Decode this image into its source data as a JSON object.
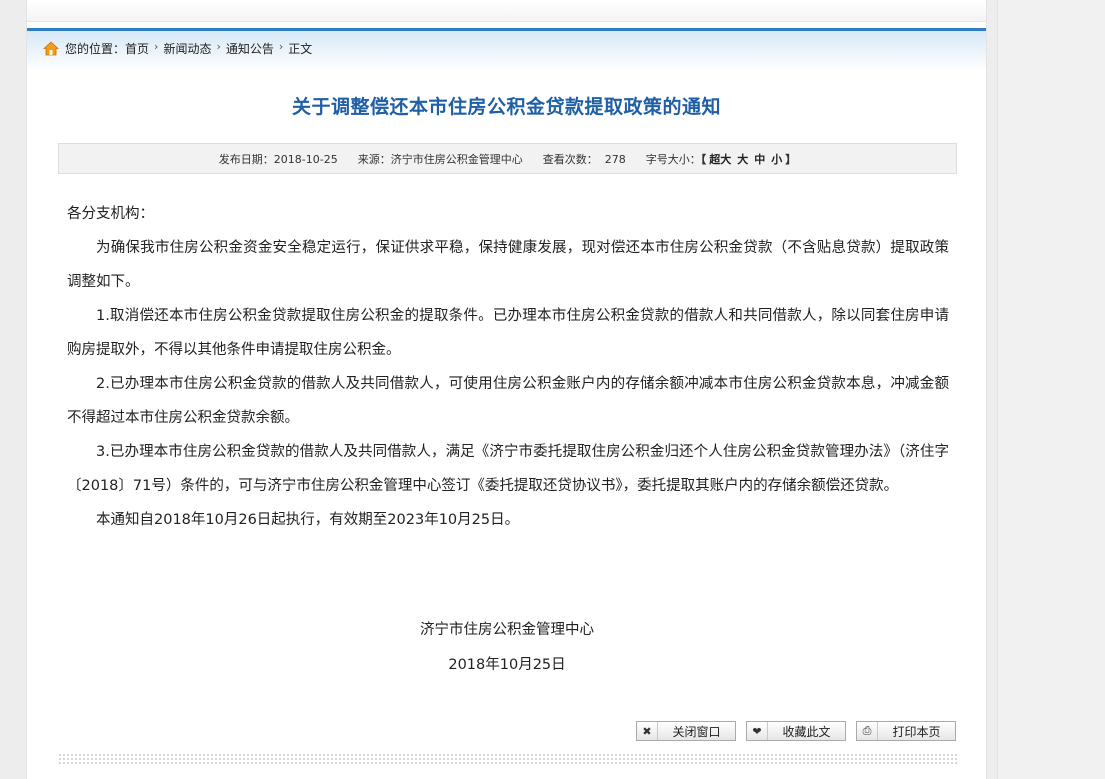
{
  "breadcrumb": {
    "label": "您的位置：",
    "items": [
      "首页",
      "新闻动态",
      "通知公告",
      "正文"
    ]
  },
  "article": {
    "title": "关于调整偿还本市住房公积金贷款提取政策的通知",
    "meta": {
      "date_label": "发布日期：",
      "date": "2018-10-25",
      "source_label": "来源：",
      "source": "济宁市住房公积金管理中心",
      "views_label": "查看次数：",
      "views": "278",
      "font_label": "字号大小：",
      "bracket_open": "【",
      "bracket_close": "】",
      "font_options": [
        "超大",
        "大",
        "中",
        "小"
      ]
    },
    "salutation": "各分支机构：",
    "paragraphs": [
      "为确保我市住房公积金资金安全稳定运行，保证供求平稳，保持健康发展，现对偿还本市住房公积金贷款（不含贴息贷款）提取政策调整如下。",
      "1.取消偿还本市住房公积金贷款提取住房公积金的提取条件。已办理本市住房公积金贷款的借款人和共同借款人，除以同套住房申请购房提取外，不得以其他条件申请提取住房公积金。",
      "2.已办理本市住房公积金贷款的借款人及共同借款人，可使用住房公积金账户内的存储余额冲减本市住房公积金贷款本息，冲减金额不得超过本市住房公积金贷款余额。",
      "3.已办理本市住房公积金贷款的借款人及共同借款人，满足《济宁市委托提取住房公积金归还个人住房公积金贷款管理办法》（济住字〔2018〕71号）条件的，可与济宁市住房公积金管理中心签订《委托提取还贷协议书》，委托提取其账户内的存储余额偿还贷款。",
      "本通知自2018年10月26日起执行，有效期至2023年10月25日。"
    ],
    "signature_org": "济宁市住房公积金管理中心",
    "signature_date": "2018年10月25日"
  },
  "actions": {
    "close_icon": "✖",
    "close_label": "关闭窗口",
    "favorite_icon": "❤",
    "favorite_label": "收藏此文",
    "print_icon": "⎙",
    "print_label": "打印本页"
  },
  "colors": {
    "title": "#1f5fa6",
    "breadcrumb_border": "#2d7fc1",
    "home_icon": "#f29b1d"
  }
}
